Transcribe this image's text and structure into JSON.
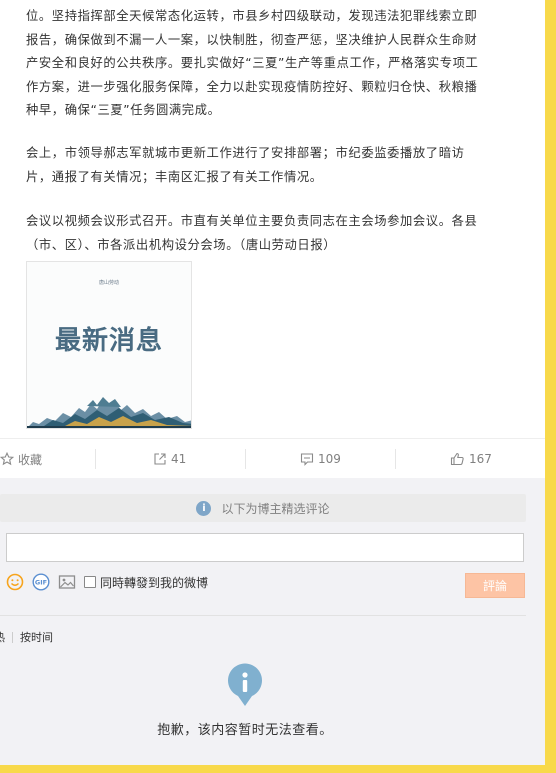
{
  "article": {
    "paragraphs": [
      "位。坚持指挥部全天候常态化运转，市县乡村四级联动，发现违法犯罪线索立即\n报告，确保做到不漏一人一案，以快制胜，彻查严惩，坚决维护人民群众生命财\n产安全和良好的公共秩序。要扎实做好“三夏”生产等重点工作，严格落实专项工\n作方案，进一步强化服务保障，全力以赴实现疫情防控好、颗粒归仓快、秋粮播\n种早，确保“三夏”任务圆满完成。",
      "会上，市领导郝志军就城市更新工作进行了安排部署；市纪委监委播放了暗访\n片，通报了有关情况；丰南区汇报了有关工作情况。",
      "会议以视频会议形式召开。市直有关单位主要负责同志在主会场参加会议。各县\n（市、区）、市各派出机构设分会场。（唐山劳动日报）"
    ],
    "image": {
      "top_text": "唐山劳动",
      "title": "最新消息"
    }
  },
  "actions": {
    "favorite": {
      "label": "收藏",
      "icon": "star-icon"
    },
    "repost": {
      "count": "41",
      "icon": "share-icon"
    },
    "comment": {
      "count": "109",
      "icon": "comment-icon"
    },
    "like": {
      "count": "167",
      "icon": "thumbs-up-icon"
    }
  },
  "comments": {
    "notice": "以下为博主精选评论",
    "input_value": "",
    "repost_checkbox_label": "同時轉發到我的微博",
    "submit_label": "評論",
    "sort_options": [
      "热",
      "按时间"
    ],
    "empty_message": "抱歉，该内容暂时无法查看。"
  },
  "colors": {
    "frame": "#f8d94a",
    "accent_info": "#7fa6c8",
    "submit_disabled": "#fdc4a5",
    "emoji": "#f7a41d"
  }
}
